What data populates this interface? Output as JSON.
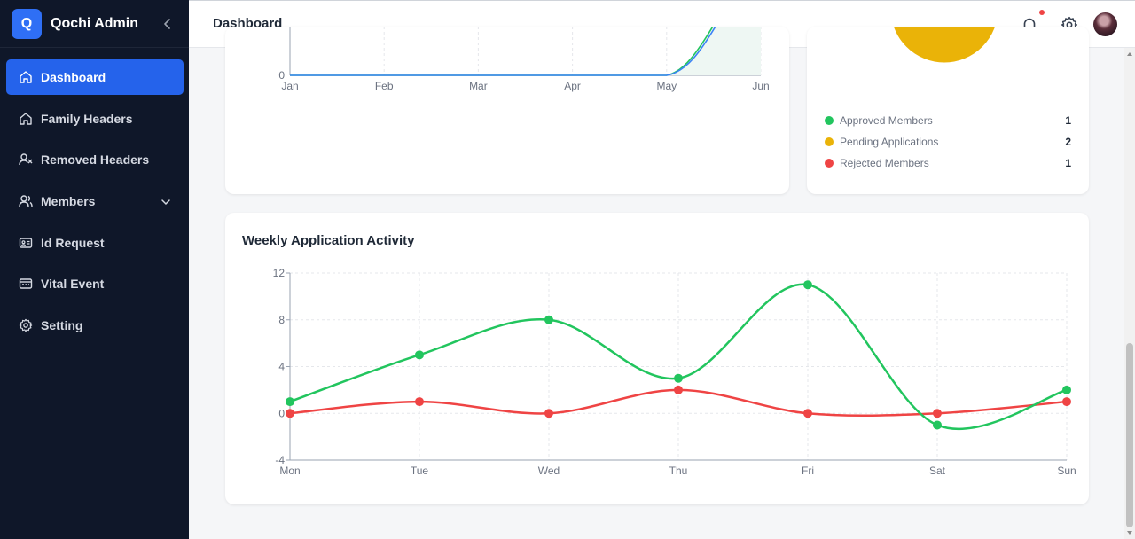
{
  "brand": {
    "logo_letter": "Q",
    "name": "Qochi Admin"
  },
  "sidebar": {
    "items": [
      {
        "label": "Dashboard",
        "icon": "home-icon",
        "active": true
      },
      {
        "label": "Family Headers",
        "icon": "home-icon"
      },
      {
        "label": "Removed Headers",
        "icon": "user-x-icon"
      },
      {
        "label": "Members",
        "icon": "users-icon",
        "has_submenu": true
      },
      {
        "label": "Id Request",
        "icon": "id-card-icon"
      },
      {
        "label": "Vital Event",
        "icon": "id-badge-icon"
      },
      {
        "label": "Setting",
        "icon": "gear-icon"
      }
    ]
  },
  "header": {
    "title": "Dashboard"
  },
  "colors": {
    "accent": "#2563eb",
    "approved": "#22c55e",
    "pending": "#eab308",
    "rejected": "#ef4444"
  },
  "status_legend": {
    "items": [
      {
        "label": "Approved Members",
        "count": "1",
        "color": "#22c55e"
      },
      {
        "label": "Pending Applications",
        "count": "2",
        "color": "#eab308"
      },
      {
        "label": "Rejected Members",
        "count": "1",
        "color": "#ef4444"
      }
    ]
  },
  "weekly": {
    "title": "Weekly Application Activity"
  },
  "chart_data": [
    {
      "type": "line",
      "title": "",
      "categories": [
        "Jan",
        "Feb",
        "Mar",
        "Apr",
        "May",
        "Jun"
      ],
      "y_ticks": [
        "0"
      ],
      "series": [
        {
          "values": [
            0,
            0,
            0,
            0,
            0,
            null
          ],
          "color": "#22c55e"
        },
        {
          "values": [
            0,
            0,
            0,
            0,
            0,
            null
          ],
          "color": "#3b82f6"
        }
      ],
      "note_visible": "partially scrolled out of view; only the 0 baseline tick is visible"
    },
    {
      "type": "pie",
      "slices": [
        {
          "label": "Approved Members",
          "value": 1,
          "color": "#22c55e"
        },
        {
          "label": "Pending Applications",
          "value": 2,
          "color": "#eab308"
        },
        {
          "label": "Rejected Members",
          "value": 1,
          "color": "#ef4444"
        }
      ]
    },
    {
      "type": "line",
      "title": "Weekly Application Activity",
      "categories": [
        "Mon",
        "Tue",
        "Wed",
        "Thu",
        "Fri",
        "Sat",
        "Sun"
      ],
      "ylim": [
        -4,
        12
      ],
      "y_ticks": [
        -4,
        0,
        4,
        8,
        12
      ],
      "grid": true,
      "series": [
        {
          "values": [
            1,
            5,
            8,
            3,
            11,
            -1,
            2
          ],
          "color": "#22c55e"
        },
        {
          "values": [
            0,
            1,
            0,
            2,
            0,
            0,
            1
          ],
          "color": "#ef4444"
        }
      ]
    }
  ]
}
